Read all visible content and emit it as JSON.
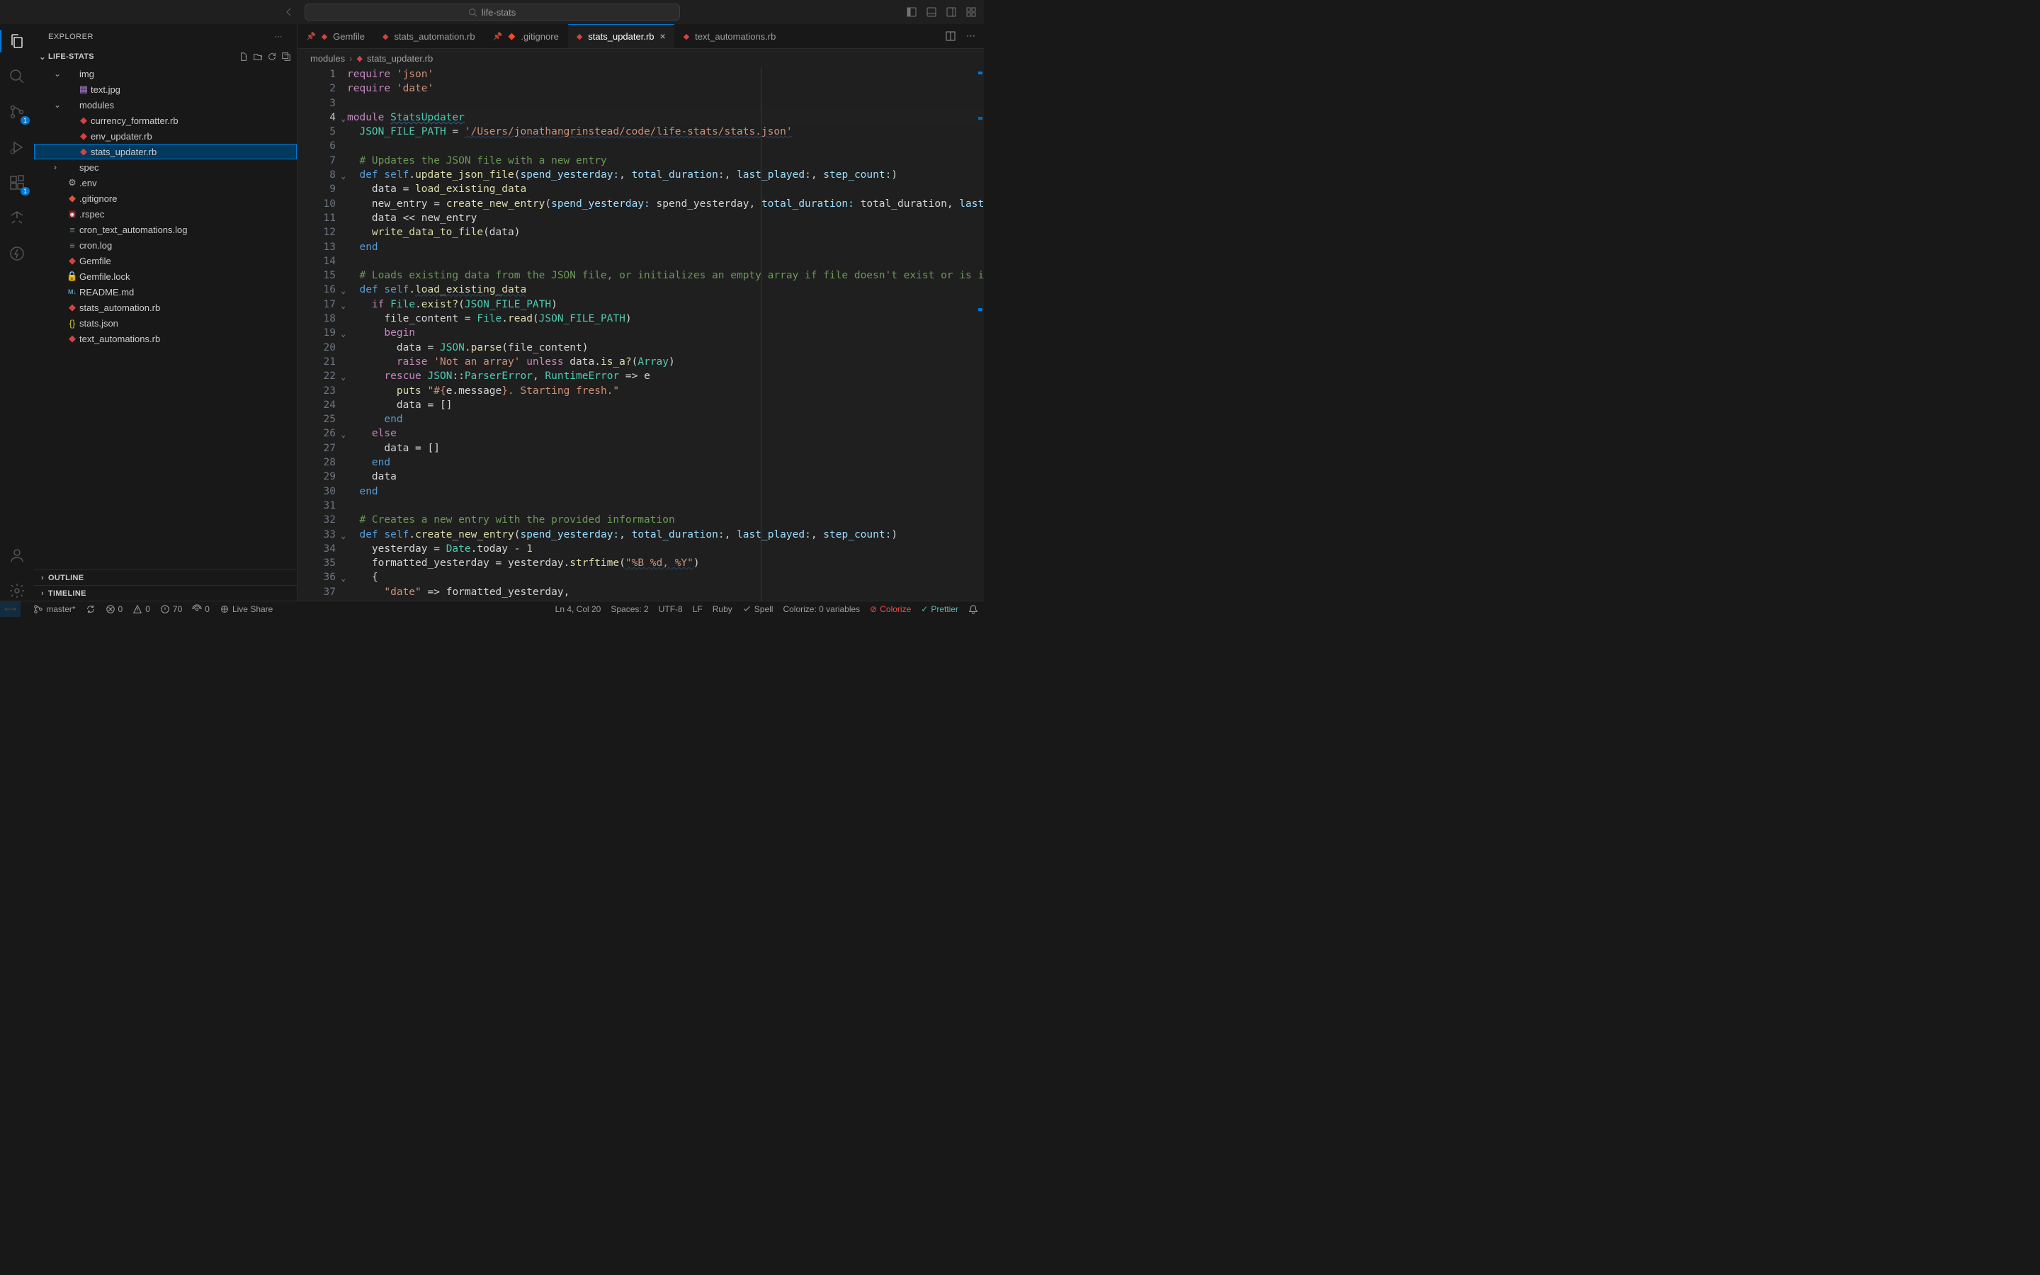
{
  "title": "life-stats",
  "search_text": "life-stats",
  "sidebar": {
    "title": "EXPLORER",
    "project": "LIFE-STATS",
    "outline": "OUTLINE",
    "timeline": "TIMELINE",
    "tree": [
      {
        "type": "folder",
        "name": "img",
        "depth": 1,
        "open": true
      },
      {
        "type": "file",
        "name": "text.jpg",
        "depth": 2,
        "icon": "img"
      },
      {
        "type": "folder",
        "name": "modules",
        "depth": 1,
        "open": true
      },
      {
        "type": "file",
        "name": "currency_formatter.rb",
        "depth": 2,
        "icon": "ruby"
      },
      {
        "type": "file",
        "name": "env_updater.rb",
        "depth": 2,
        "icon": "ruby"
      },
      {
        "type": "file",
        "name": "stats_updater.rb",
        "depth": 2,
        "icon": "ruby",
        "selected": true
      },
      {
        "type": "folder",
        "name": "spec",
        "depth": 1,
        "open": false
      },
      {
        "type": "file",
        "name": ".env",
        "depth": 1,
        "icon": "env"
      },
      {
        "type": "file",
        "name": ".gitignore",
        "depth": 1,
        "icon": "git"
      },
      {
        "type": "file",
        "name": ".rspec",
        "depth": 1,
        "icon": "rspec"
      },
      {
        "type": "file",
        "name": "cron_text_automations.log",
        "depth": 1,
        "icon": "log"
      },
      {
        "type": "file",
        "name": "cron.log",
        "depth": 1,
        "icon": "log"
      },
      {
        "type": "file",
        "name": "Gemfile",
        "depth": 1,
        "icon": "ruby"
      },
      {
        "type": "file",
        "name": "Gemfile.lock",
        "depth": 1,
        "icon": "lock"
      },
      {
        "type": "file",
        "name": "README.md",
        "depth": 1,
        "icon": "md"
      },
      {
        "type": "file",
        "name": "stats_automation.rb",
        "depth": 1,
        "icon": "ruby"
      },
      {
        "type": "file",
        "name": "stats.json",
        "depth": 1,
        "icon": "json"
      },
      {
        "type": "file",
        "name": "text_automations.rb",
        "depth": 1,
        "icon": "ruby"
      }
    ]
  },
  "tabs": [
    {
      "label": "Gemfile",
      "icon": "ruby",
      "pinned": true
    },
    {
      "label": "stats_automation.rb",
      "icon": "ruby"
    },
    {
      "label": ".gitignore",
      "icon": "git",
      "pinned": true
    },
    {
      "label": "stats_updater.rb",
      "icon": "ruby",
      "active": true,
      "close": true
    },
    {
      "label": "text_automations.rb",
      "icon": "ruby"
    }
  ],
  "breadcrumbs": [
    "modules",
    "stats_updater.rb"
  ],
  "activity_badges": {
    "scm": "1",
    "ext": "1"
  },
  "code_lines": [
    {
      "n": 1,
      "html": "<span class='kw'>require</span> <span class='str'>'json'</span>"
    },
    {
      "n": 2,
      "html": "<span class='kw'>require</span> <span class='str'>'date'</span>"
    },
    {
      "n": 3,
      "html": ""
    },
    {
      "n": 4,
      "html": "<span class='kw'>module</span> <span class='const squig2'>StatsUpdater</span>",
      "cur": true,
      "fold": true
    },
    {
      "n": 5,
      "html": "  <span class='const'>JSON_FILE_PATH</span> <span class='op'>=</span> <span class='str squig'>'/Users/jonathangrinstead/code/life-stats/stats.json'</span>"
    },
    {
      "n": 6,
      "html": ""
    },
    {
      "n": 7,
      "html": "  <span class='cmt'># Updates the JSON file with a new entry</span>"
    },
    {
      "n": 8,
      "html": "  <span class='def'>def</span> <span class='self'>self</span>.<span class='fn'>update_json_file</span>(<span class='par'>spend_yesterday:</span>, <span class='par'>total_duration:</span>, <span class='par'>last_played:</span>, <span class='par'>step_count:</span>)",
      "fold": true
    },
    {
      "n": 9,
      "html": "    data <span class='op'>=</span> <span class='fn'>load_existing_data</span>"
    },
    {
      "n": 10,
      "html": "    new_entry <span class='op'>=</span> <span class='fn'>create_new_entry</span>(<span class='par'>spend_yesterday:</span> spend_yesterday, <span class='par'>total_duration:</span> total_duration, <span class='par'>last_played</span>"
    },
    {
      "n": 11,
      "html": "    data <span class='op'>&lt;&lt;</span> new_entry"
    },
    {
      "n": 12,
      "html": "    <span class='fn'>write_data_to_file</span>(data)"
    },
    {
      "n": 13,
      "html": "  <span class='def'>end</span>"
    },
    {
      "n": 14,
      "html": ""
    },
    {
      "n": 15,
      "html": "  <span class='cmt'># Loads existing data from the JSON file, or initializes an empty array if file doesn't exist or is invalid</span>"
    },
    {
      "n": 16,
      "html": "  <span class='def'>def</span> <span class='self'>self</span>.<span class='fn squig'>load_existing_data</span>",
      "fold": true
    },
    {
      "n": 17,
      "html": "    <span class='kw'>if</span> <span class='const'>File</span>.<span class='fn'>exist?</span>(<span class='const'>JSON_FILE_PATH</span>)",
      "fold": true
    },
    {
      "n": 18,
      "html": "      file_content <span class='op'>=</span> <span class='const'>File</span>.<span class='fn'>read</span>(<span class='const'>JSON_FILE_PATH</span>)"
    },
    {
      "n": 19,
      "html": "      <span class='kw'>begin</span>",
      "fold": true
    },
    {
      "n": 20,
      "html": "        data <span class='op'>=</span> <span class='const'>JSON</span>.<span class='fn'>parse</span>(file_content)"
    },
    {
      "n": 21,
      "html": "        <span class='kw'>raise</span> <span class='str'>'Not an array'</span> <span class='kw'>unless</span> data.<span class='fn'>is_a?</span>(<span class='const'>Array</span>)"
    },
    {
      "n": 22,
      "html": "      <span class='kw'>rescue</span> <span class='const'>JSON</span>::<span class='const'>ParserError</span>, <span class='const'>RuntimeError</span> <span class='op'>=&gt;</span> e",
      "fold": true
    },
    {
      "n": 23,
      "html": "        <span class='fn'>puts</span> <span class='str'>\"#{</span>e.message<span class='str'>}. Starting fresh.\"</span>"
    },
    {
      "n": 24,
      "html": "        data <span class='op'>=</span> []"
    },
    {
      "n": 25,
      "html": "      <span class='def'>end</span>"
    },
    {
      "n": 26,
      "html": "    <span class='kw'>else</span>",
      "fold": true
    },
    {
      "n": 27,
      "html": "      data <span class='op'>=</span> []"
    },
    {
      "n": 28,
      "html": "    <span class='def'>end</span>"
    },
    {
      "n": 29,
      "html": "    data"
    },
    {
      "n": 30,
      "html": "  <span class='def'>end</span>"
    },
    {
      "n": 31,
      "html": ""
    },
    {
      "n": 32,
      "html": "  <span class='cmt'># Creates a new entry with the provided information</span>"
    },
    {
      "n": 33,
      "html": "  <span class='def'>def</span> <span class='self'>self</span>.<span class='fn'>create_new_entry</span>(<span class='par'>spend_yesterday:</span>, <span class='par'>total_duration:</span>, <span class='par'>last_played:</span>, <span class='par'>step_count:</span>)",
      "fold": true
    },
    {
      "n": 34,
      "html": "    yesterday <span class='op'>=</span> <span class='const'>Date</span>.today <span class='op'>-</span> <span class='num'>1</span>"
    },
    {
      "n": 35,
      "html": "    formatted_yesterday <span class='op'>=</span> yesterday.<span class='fn'>strftime</span>(<span class='str squig'>\"%B %d, %Y\"</span>)"
    },
    {
      "n": 36,
      "html": "    {",
      "fold": true
    },
    {
      "n": 37,
      "html": "      <span class='str'>\"date\"</span> <span class='op'>=&gt;</span> formatted_yesterday,"
    }
  ],
  "statusbar": {
    "branch": "master*",
    "sync": "",
    "errors": "0",
    "warnings": "0",
    "hints": "70",
    "ports": "0",
    "liveshare": "Live Share",
    "cursor": "Ln 4, Col 20",
    "spaces": "Spaces: 2",
    "encoding": "UTF-8",
    "eol": "LF",
    "lang": "Ruby",
    "spell": "Spell",
    "colorize_vars": "Colorize: 0 variables",
    "colorize": "Colorize",
    "prettier": "Prettier"
  }
}
